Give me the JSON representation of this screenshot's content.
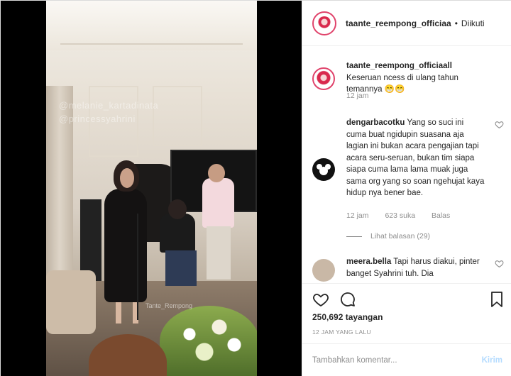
{
  "header": {
    "username": "taante_reempong_officiaa",
    "separator": "•",
    "follow_status": "Diikuti"
  },
  "video": {
    "watermark_line1": "@melanie_kartadinata",
    "watermark_line2": "@princessyahrini",
    "watermark_bottom": "Tante_Rempong"
  },
  "caption": {
    "username": "taante_reempong_officiaall",
    "text": "Keseruan ncess di ulang tahun temannya 😁😁",
    "time": "12 jam"
  },
  "comments": [
    {
      "username": "dengarbacotku",
      "text": "Yang so suci ini cuma buat ngidupin suasana aja lagian ini bukan acara pengajian tapi acara seru-seruan, bukan tim siapa siapa cuma lama lama muak juga sama org yang so soan ngehujat kaya hidup nya bener bae.",
      "time": "12 jam",
      "likes": "623 suka",
      "reply": "Balas",
      "view_replies": "Lihat balasan (29)"
    },
    {
      "username": "meera.bella",
      "text": "Tapi harus diakui, pinter banget Syahrini tuh. Dia"
    }
  ],
  "actions": {
    "views": "250,692 tayangan",
    "posted": "12 JAM YANG LALU"
  },
  "comment_box": {
    "placeholder": "Tambahkan komentar...",
    "post_label": "Kirim"
  }
}
